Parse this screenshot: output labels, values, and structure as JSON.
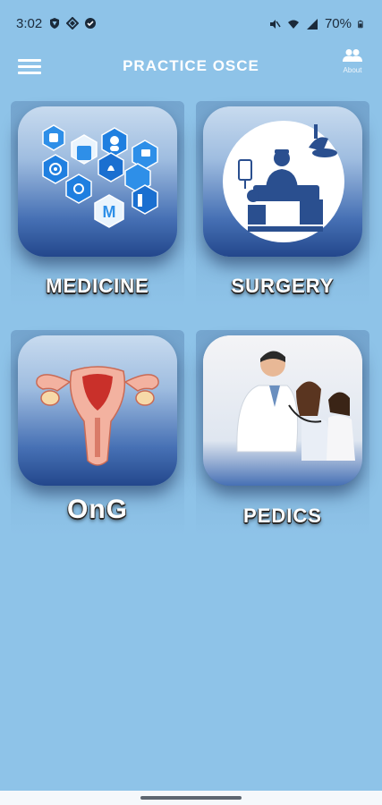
{
  "status_bar": {
    "time": "3:02",
    "battery": "70%",
    "icons_left": [
      "shield-icon",
      "diamond-icon",
      "check-circle-icon"
    ],
    "icons_right": [
      "mute-icon",
      "wifi-icon",
      "signal-icon",
      "battery-icon"
    ]
  },
  "app_bar": {
    "title": "PRACTICE OSCE",
    "about_label": "About",
    "menu_icon": "hamburger-menu-icon",
    "about_icon": "people-icon"
  },
  "tiles": [
    {
      "label": "MEDICINE",
      "art": "medical-hexagon-icons"
    },
    {
      "label": "SURGERY",
      "art": "surgeon-operating-icon"
    },
    {
      "label": "OnG",
      "art": "uterus-illustration"
    },
    {
      "label": "PEDICS",
      "art": "doctor-with-child-photo"
    }
  ],
  "colors": {
    "background": "#8ec3e8",
    "card_dark": "#23478c",
    "card_light": "#c8dbef"
  }
}
